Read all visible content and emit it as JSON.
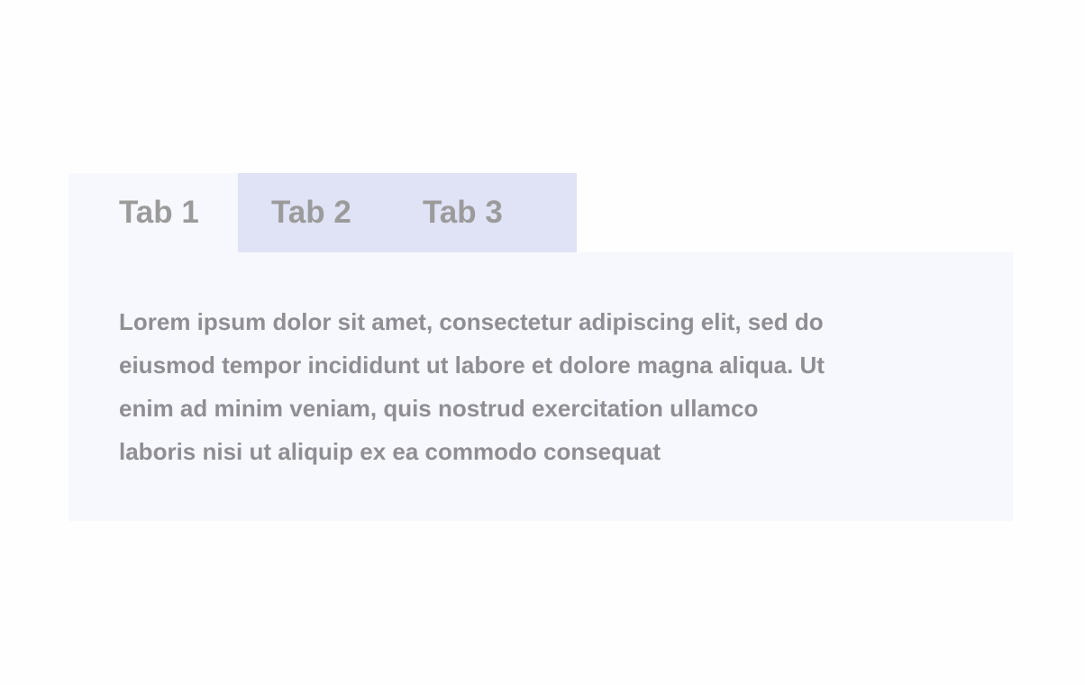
{
  "tabs": [
    {
      "label": "Tab 1",
      "active": true
    },
    {
      "label": "Tab 2",
      "active": false
    },
    {
      "label": "Tab 3",
      "active": false
    }
  ],
  "panel": {
    "lines": [
      "Lorem ipsum dolor sit amet, consectetur adipiscing elit, sed do",
      "eiusmod tempor incididunt ut labore et dolore magna aliqua. Ut",
      "enim ad minim veniam, quis nostrud exercitation ullamco",
      "laboris nisi ut aliquip ex ea commodo consequat"
    ]
  },
  "colors": {
    "active_tab_bg": "#f7f8fd",
    "inactive_tab_bg": "#e0e3f5",
    "text": "#8f8e93"
  }
}
